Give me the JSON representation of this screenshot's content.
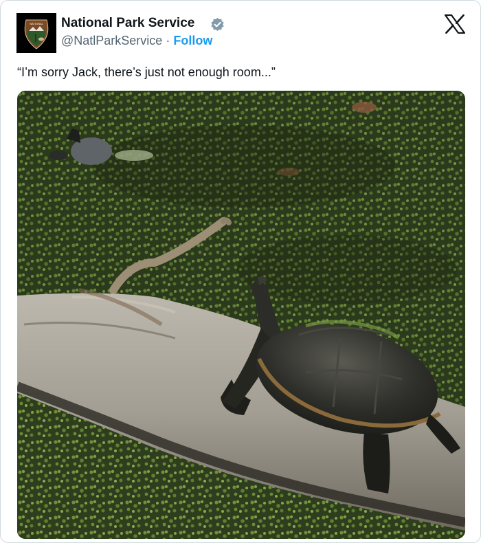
{
  "tweet": {
    "author_name": "National Park Service",
    "author_handle": "@NatlParkService",
    "separator": "·",
    "follow_label": "Follow",
    "text": "“I’m sorry Jack, there’s just not enough room...”",
    "verified": true
  },
  "icons": {
    "avatar": "nps-arrowhead-logo",
    "badge": "verified-check-icon",
    "platform": "x-logo-icon"
  },
  "colors": {
    "follow": "#1d9bf0",
    "handle": "#536471",
    "verified_badge": "#829aab"
  }
}
